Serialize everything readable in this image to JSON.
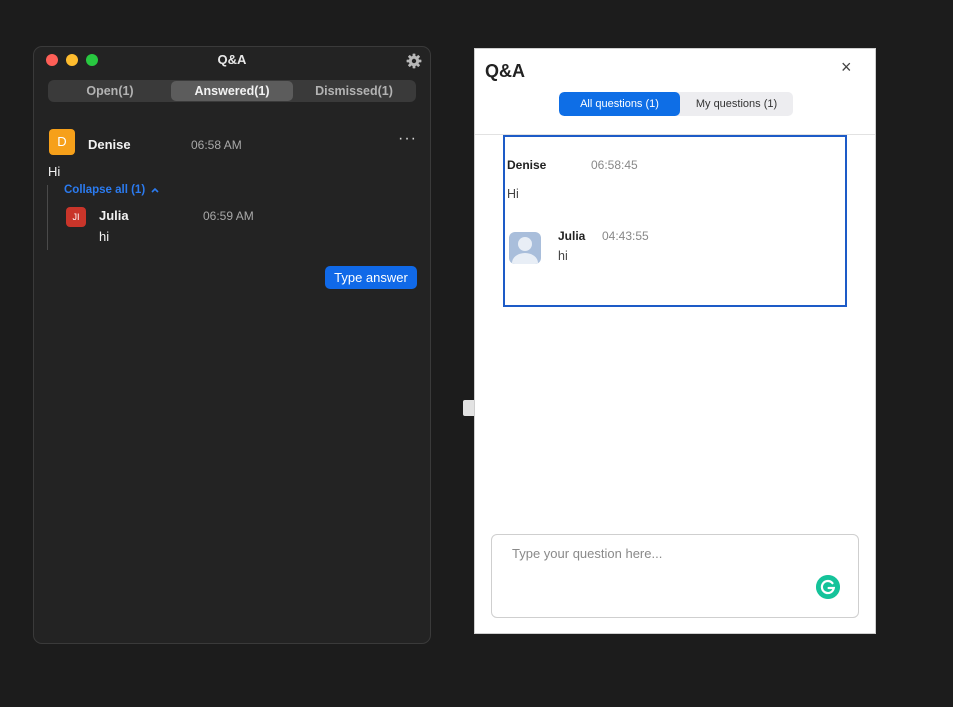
{
  "host_window": {
    "title": "Q&A",
    "tabs": [
      {
        "label": "Open(1)",
        "active": false
      },
      {
        "label": "Answered(1)",
        "active": true
      },
      {
        "label": "Dismissed(1)",
        "active": false
      }
    ],
    "question": {
      "avatar_letter": "D",
      "avatar_color": "#f6a01a",
      "name": "Denise",
      "time": "06:58 AM",
      "text": "Hi",
      "more_label": "···"
    },
    "collapse_label": "Collapse all (1)",
    "reply": {
      "avatar_letter": "JI",
      "avatar_color": "#c9352a",
      "name": "Julia",
      "time": "06:59 AM",
      "text": "hi"
    },
    "type_answer_label": "Type answer"
  },
  "qa_panel": {
    "title": "Q&A",
    "close_label": "×",
    "tabs": [
      {
        "label": "All questions (1)",
        "active": true
      },
      {
        "label": "My questions (1)",
        "active": false
      }
    ],
    "question": {
      "name": "Denise",
      "time": "06:58:45",
      "text": "Hi"
    },
    "answer": {
      "name": "Julia",
      "time": "04:43:55",
      "text": "hi"
    },
    "input_placeholder": "Type your question here..."
  },
  "colors": {
    "accent_blue": "#0e6ee6",
    "grammarly_green": "#15c39a"
  }
}
